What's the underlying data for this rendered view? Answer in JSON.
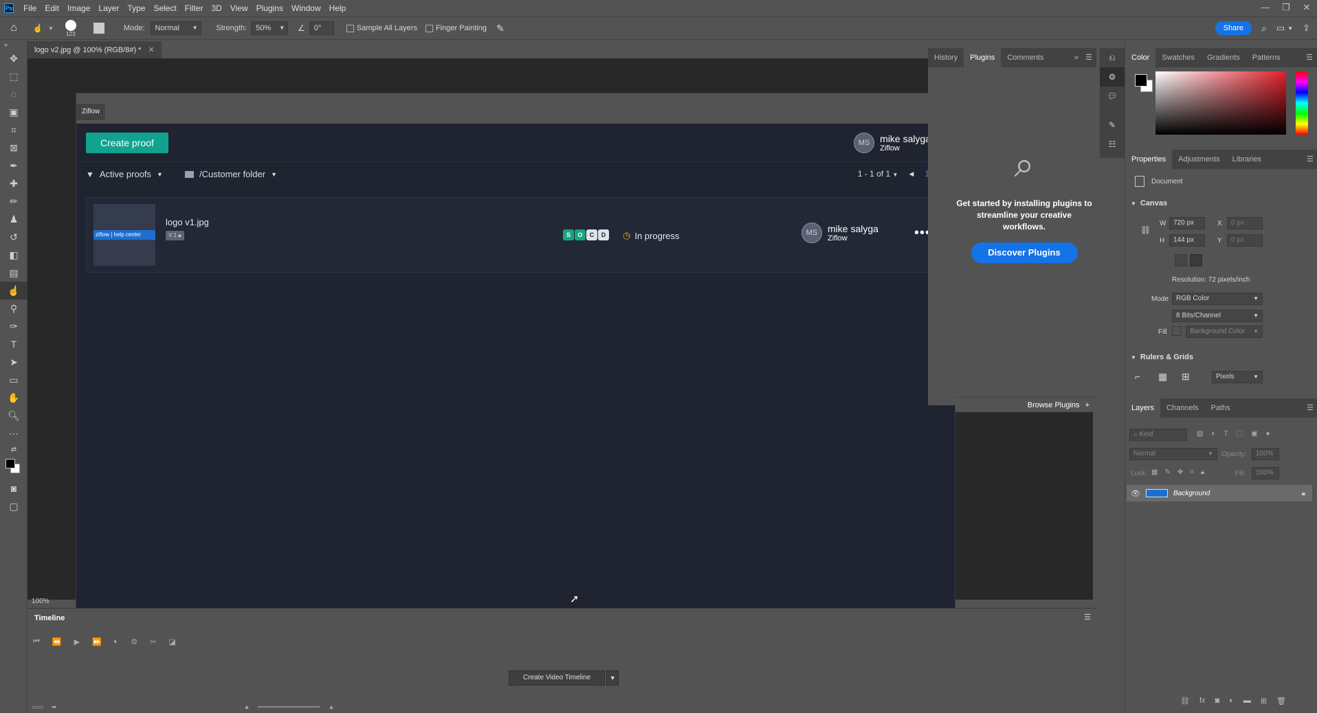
{
  "menubar": {
    "app_logo": "Ps",
    "items": [
      "File",
      "Edit",
      "Image",
      "Layer",
      "Type",
      "Select",
      "Filter",
      "3D",
      "View",
      "Plugins",
      "Window",
      "Help"
    ]
  },
  "options_bar": {
    "brush_size": "123",
    "mode_label": "Mode:",
    "mode_value": "Normal",
    "strength_label": "Strength:",
    "strength_value": "50%",
    "angle_value": "0°",
    "sample_all_layers": "Sample All Layers",
    "finger_painting": "Finger Painting",
    "share": "Share"
  },
  "document": {
    "tab_title": "logo v2.jpg @ 100% (RGB/8#) *",
    "zoom": "100%"
  },
  "ziflow": {
    "window_title": "Ziflow",
    "create_proof": "Create proof",
    "user": {
      "initials": "MS",
      "name": "mike salyga",
      "org": "Ziflow"
    },
    "filter": "Active proofs",
    "folder": "/Customer folder",
    "pagination": "1 - 1 of 1",
    "page_number": "1",
    "proofs": [
      {
        "name": "logo v1.jpg",
        "version": "V 1",
        "thumb_text": "ziflow | help center",
        "badges": [
          "S",
          "O",
          "C",
          "D"
        ],
        "status": "In progress",
        "owner_initials": "MS",
        "owner_name": "mike salyga",
        "owner_org": "Ziflow"
      }
    ]
  },
  "plugins_panel": {
    "tabs": [
      "History",
      "Plugins",
      "Comments"
    ],
    "active_tab": "Plugins",
    "message": "Get started by installing plugins to streamline your creative workflows.",
    "discover": "Discover Plugins",
    "browse": "Browse Plugins"
  },
  "color_panel": {
    "tabs": [
      "Color",
      "Swatches",
      "Gradients",
      "Patterns"
    ]
  },
  "properties_panel": {
    "tabs": [
      "Properties",
      "Adjustments",
      "Libraries"
    ],
    "document_label": "Document",
    "canvas_title": "Canvas",
    "w_label": "W",
    "w_value": "720 px",
    "h_label": "H",
    "h_value": "144 px",
    "x_label": "X",
    "x_placeholder": "0 px",
    "y_label": "Y",
    "y_placeholder": "0 px",
    "resolution": "Resolution: 72 pixels/inch",
    "mode_label": "Mode",
    "mode_value": "RGB Color",
    "bits_value": "8 Bits/Channel",
    "fill_label": "Fill",
    "fill_value": "Background Color",
    "rulers_title": "Rulers & Grids",
    "units_value": "Pixels"
  },
  "layers_panel": {
    "tabs": [
      "Layers",
      "Channels",
      "Paths"
    ],
    "kind_placeholder": "Kind",
    "blend_mode": "Normal",
    "opacity_label": "Opacity:",
    "opacity_value": "100%",
    "lock_label": "Lock:",
    "fill_label": "Fill:",
    "fill_value": "100%",
    "layer_name": "Background"
  },
  "timeline": {
    "title": "Timeline",
    "create_button": "Create Video Timeline"
  }
}
